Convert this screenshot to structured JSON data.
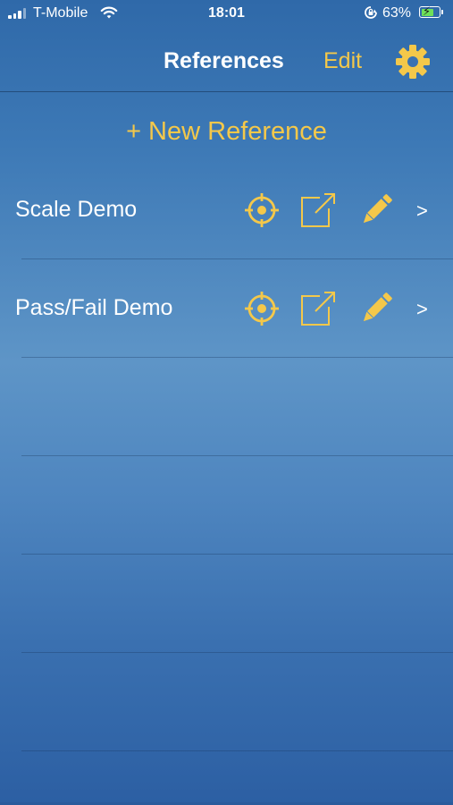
{
  "status_bar": {
    "carrier": "T-Mobile",
    "time": "18:01",
    "battery_percent": "63%",
    "battery_level": 0.63,
    "battery_color": "#6ee05a",
    "icons": [
      "signal-icon",
      "wifi-icon",
      "orientation-lock-icon",
      "battery-charging-icon"
    ]
  },
  "nav": {
    "title": "References",
    "edit_label": "Edit",
    "settings_icon": "gear-icon",
    "accent_color": "#f4c84a"
  },
  "new_reference_label": "+ New Reference",
  "references": [
    {
      "title": "Scale Demo",
      "actions": [
        "target-icon",
        "export-icon",
        "pencil-icon"
      ],
      "chevron": ">"
    },
    {
      "title": "Pass/Fail Demo",
      "actions": [
        "target-icon",
        "export-icon",
        "pencil-icon"
      ],
      "chevron": ">"
    }
  ]
}
